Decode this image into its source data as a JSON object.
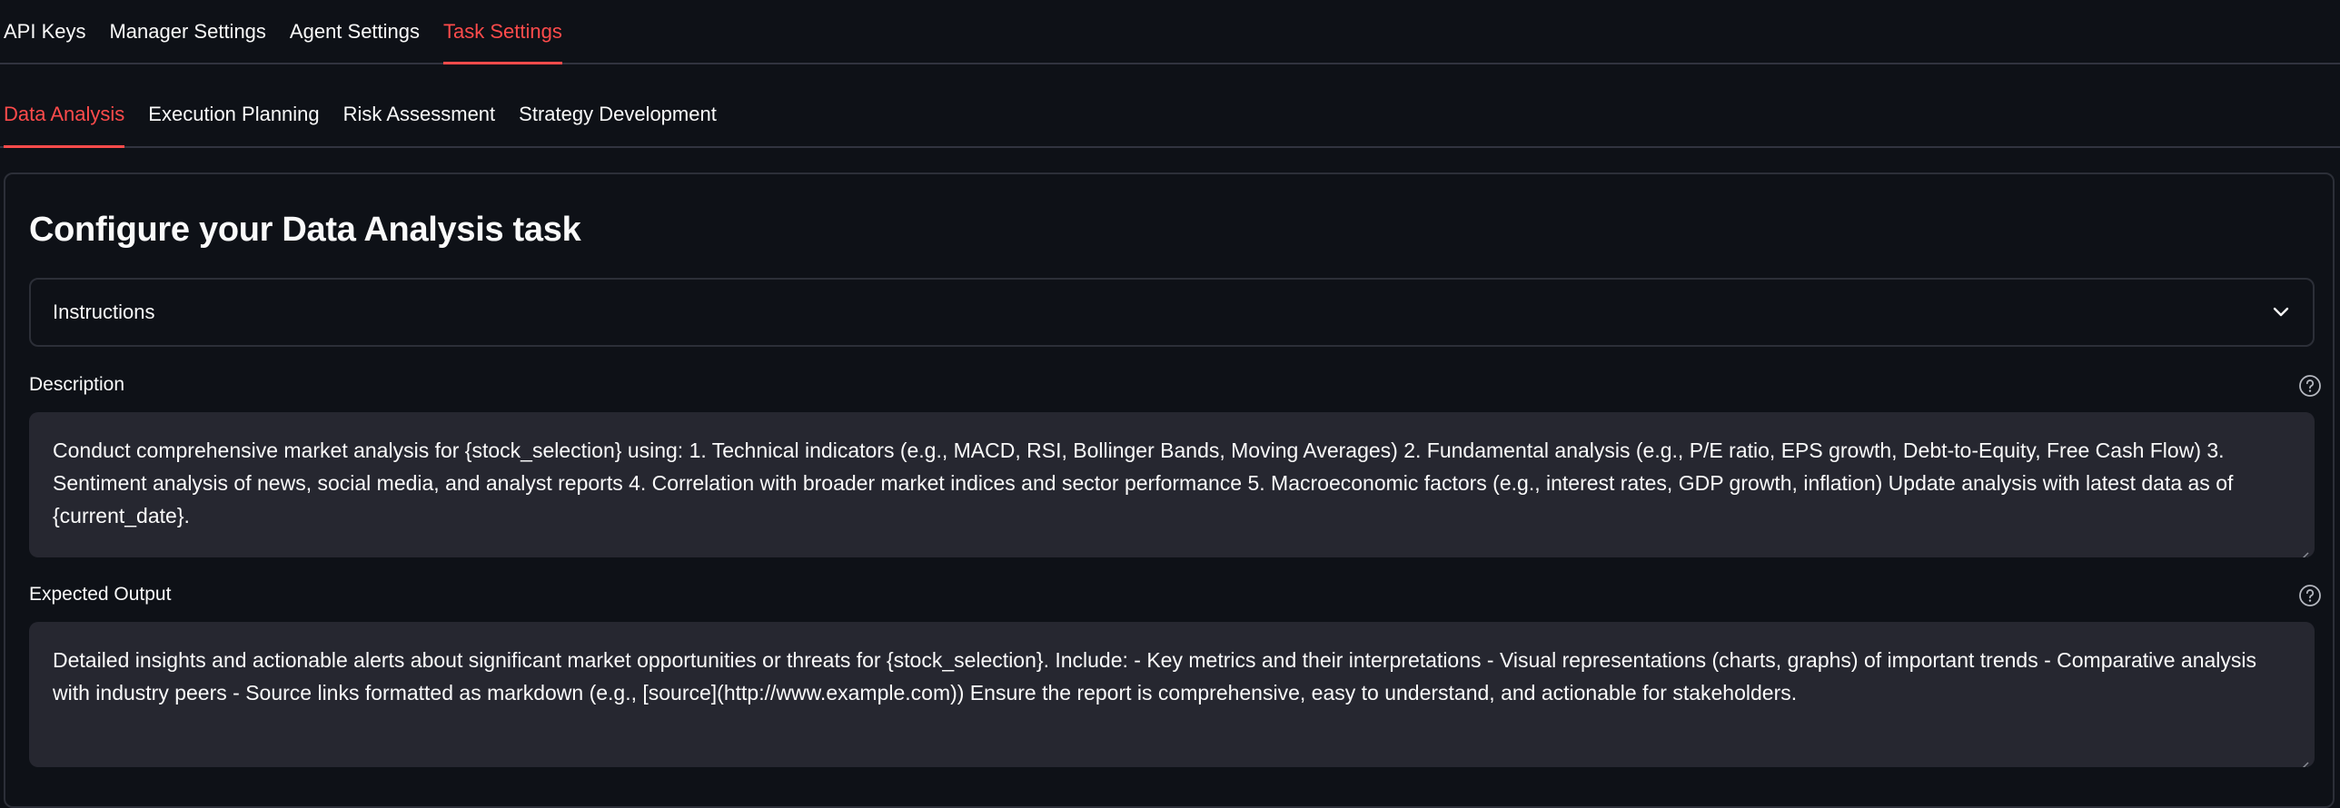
{
  "top_tabs": [
    {
      "label": "API Keys",
      "active": false
    },
    {
      "label": "Manager Settings",
      "active": false
    },
    {
      "label": "Agent Settings",
      "active": false
    },
    {
      "label": "Task Settings",
      "active": true
    }
  ],
  "sub_tabs": [
    {
      "label": "Data Analysis",
      "active": true
    },
    {
      "label": "Execution Planning",
      "active": false
    },
    {
      "label": "Risk Assessment",
      "active": false
    },
    {
      "label": "Strategy Development",
      "active": false
    }
  ],
  "panel": {
    "title": "Configure your Data Analysis task",
    "instructions_label": "Instructions",
    "description": {
      "label": "Description",
      "value": "Conduct comprehensive market analysis for {stock_selection} using: 1. Technical indicators (e.g., MACD, RSI, Bollinger Bands, Moving Averages) 2. Fundamental analysis (e.g., P/E ratio, EPS growth, Debt-to-Equity, Free Cash Flow) 3. Sentiment analysis of news, social media, and analyst reports 4. Correlation with broader market indices and sector performance 5. Macroeconomic factors (e.g., interest rates, GDP growth, inflation) Update analysis with latest data as of {current_date}."
    },
    "expected_output": {
      "label": "Expected Output",
      "value": "Detailed insights and actionable alerts about significant market  opportunities or threats for {stock_selection}. Include: - Key metrics and their interpretations - Visual representations (charts, graphs) of important trends - Comparative analysis with industry peers - Source links formatted as markdown (e.g., [source](http://www.example.com)) Ensure the report is comprehensive, easy to understand, and actionable for stakeholders."
    }
  },
  "colors": {
    "background": "#0e1117",
    "accent": "#ff4b4b",
    "input_bg": "#262730",
    "border": "#2c2f38"
  },
  "icons": {
    "expander": "chevron-down-icon",
    "help": "question-circle-icon"
  }
}
